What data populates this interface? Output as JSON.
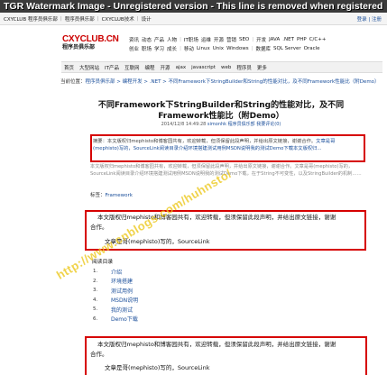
{
  "watermark_banner": "TGR Watermark Image - Unregistered version - This line is removed when registered",
  "topbar": {
    "items": [
      "CXYCLUB 程序员俱乐部",
      "程序员俱乐部",
      "CXYCLUB技术",
      "设计"
    ],
    "right": "登录 | 注册"
  },
  "logo": {
    "main": "CXYCLUB.CN",
    "sub": "程序员俱乐部"
  },
  "nav": {
    "row1": [
      "资讯",
      "动态",
      "产品",
      "人物",
      "|",
      "IT职场",
      "运维",
      "开源",
      "营销",
      "SEO",
      "|",
      "开发",
      "JAVA",
      ".NET",
      "PHP",
      "C/C++"
    ],
    "row2": [
      "创业",
      "职场",
      "学习",
      "成长",
      "|",
      "移动",
      "Linux",
      "Unix",
      "Windows",
      "|",
      "数据库",
      "SQL Server",
      "Oracle"
    ]
  },
  "catbar": [
    "首页",
    "大型网站",
    "IT产品",
    "互联网",
    "编程",
    "开源",
    "ajax",
    "javascript",
    "web",
    "程序员",
    "更多"
  ],
  "breadcrumb": {
    "label": "当前位置：",
    "path": "程序员俱乐部 > 编程开发 > .NET > 不同Framework下StringBuilder和String的性能对比，及不同Framework性能比（附Demo）"
  },
  "article": {
    "title": "不同Framework下StringBuilder和String的性能对比，及不同Framework性能比（附Demo）",
    "meta_date": "2014/12/8 14:49:28",
    "meta_author": "simonhk",
    "meta_source": "程序员俱乐部",
    "meta_views": "我要评论(0)",
    "summary_lead": "摘要：本文版权归mephisto和博客园共有，欢迎转载，但须保留此段声明，并给出原文链接，谢谢合作。",
    "summary_link": "文章是哥(mephisto)写的，SourceLink阅读目录介绍环境搭建测试用例MSDN说明我的测试Demo下载本文版权归...",
    "paragraph": "本文版权归mephisto和博客园共有，欢迎转载，但须保留此段声明，并给出原文链接，谢谢合作。文章是哥(mephisto)写的，SourceLink阅读目录介绍环境搭建测试用例MSDN说明我的测试Demo下载，在于String不可变性，以及StringBuilder的机制……",
    "tag_label": "标签：",
    "tag_value": "Framework"
  },
  "notice": {
    "line1": "本文版权归mephisto和博客园共有，欢迎转载，但须保留此段声明，并给出原文链接，谢谢",
    "line2": "合作。",
    "line3": "文章是哥(mephisto)写的，SourceLink"
  },
  "toc": {
    "title": "阅读目录",
    "items": [
      {
        "num": "1.",
        "label": "介绍"
      },
      {
        "num": "2.",
        "label": "环境搭建"
      },
      {
        "num": "3.",
        "label": "测试用例"
      },
      {
        "num": "4.",
        "label": "MSDN说明"
      },
      {
        "num": "5.",
        "label": "我的测试"
      },
      {
        "num": "6.",
        "label": "Demo下载"
      }
    ]
  },
  "notice2": {
    "line1": "本文版权归mephisto和博客园共有，欢迎转载，但须保留此段声明，并给出原文链接，谢谢",
    "line2": "合作。",
    "line3": "文章是哥(mephisto)写的，SourceLink"
  },
  "overlay_watermark": "http://www.cnblogs.com/huhnsto/",
  "colors": {
    "highlight_box": "#d60000",
    "link": "#1a4e9a",
    "watermark": "#ecc81e"
  }
}
